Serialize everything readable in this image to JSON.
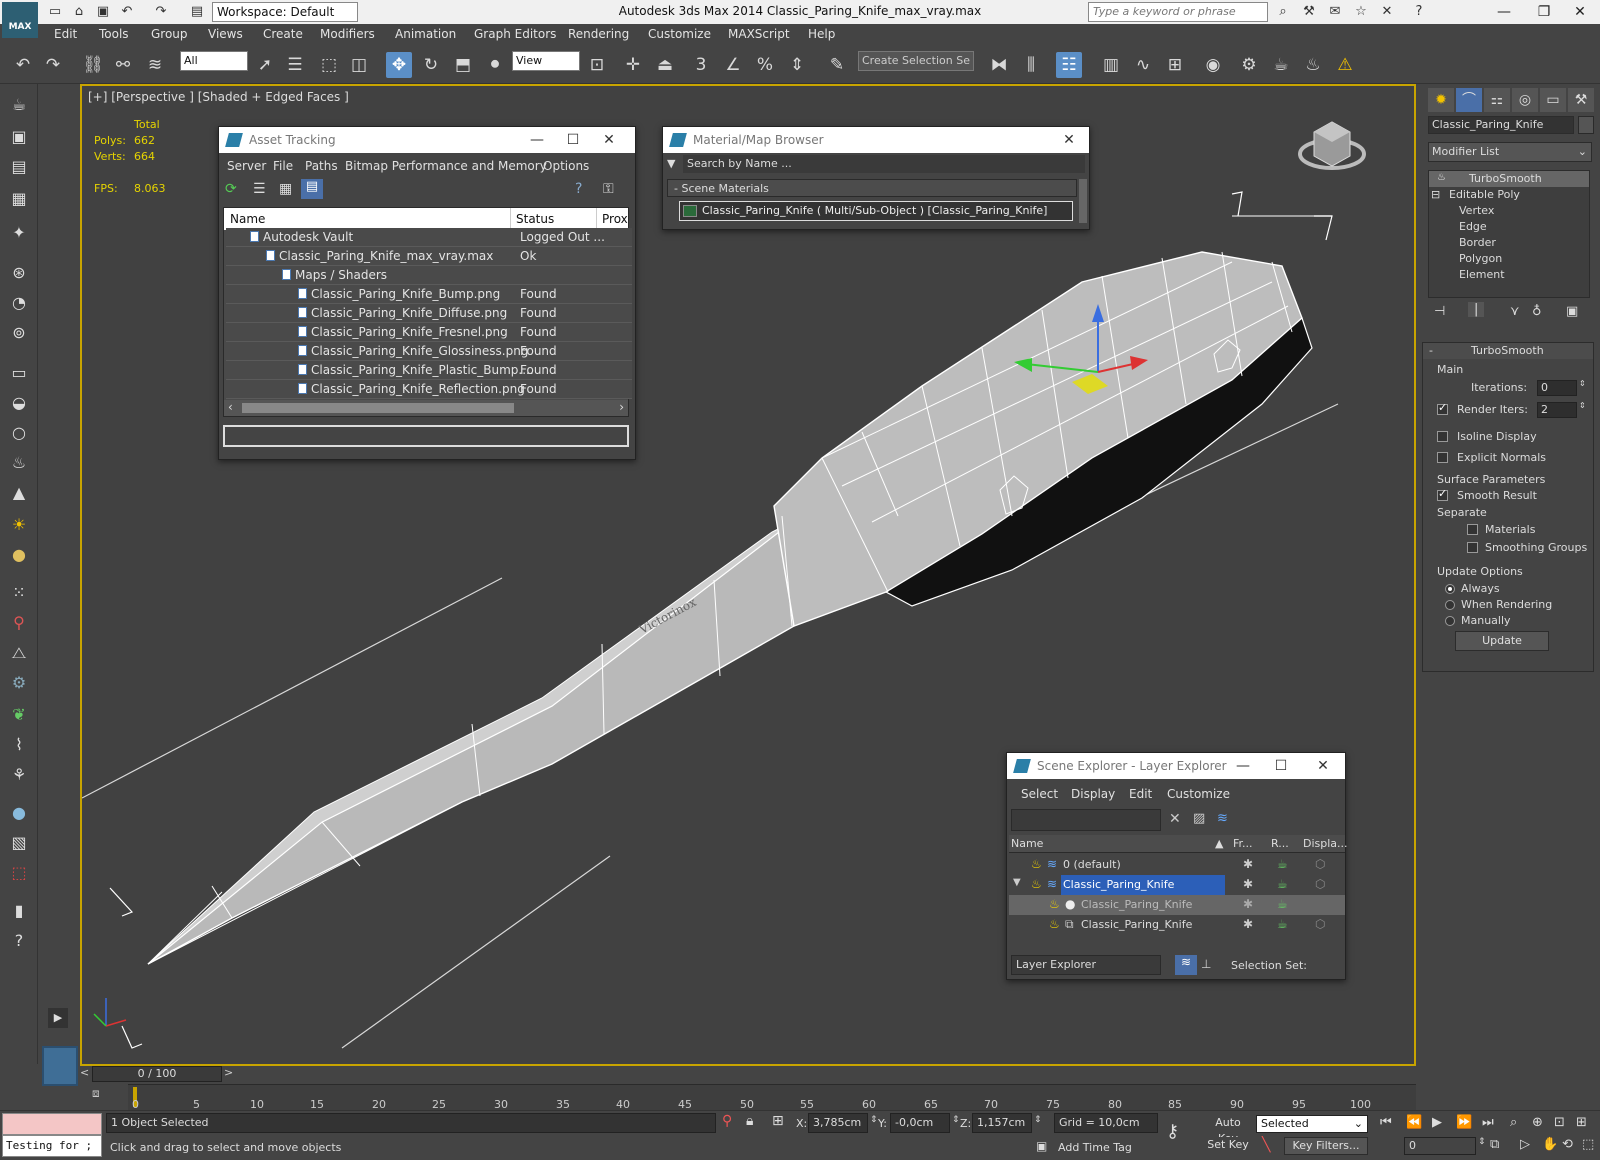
{
  "window": {
    "app_logo": "MAX",
    "workspace": "Workspace: Default",
    "title": "Autodesk 3ds Max  2014     Classic_Paring_Knife_max_vray.max",
    "search_placeholder": "Type a keyword or phrase"
  },
  "menu": [
    "Edit",
    "Tools",
    "Group",
    "Views",
    "Create",
    "Modifiers",
    "Animation",
    "Graph Editors",
    "Rendering",
    "Customize",
    "MAXScript",
    "Help"
  ],
  "toolbar": {
    "filter": "All",
    "ref_coord": "View",
    "selection_set_placeholder": "Create Selection Se",
    "snap_label": "3",
    "angle_label": "%"
  },
  "viewport": {
    "label": "[+] [Perspective ] [Shaded + Edged Faces ]",
    "stats": {
      "total_label": "Total",
      "polys_label": "Polys:",
      "polys": "662",
      "verts_label": "Verts:",
      "verts": "664",
      "fps_label": "FPS:",
      "fps": "8.063"
    }
  },
  "asset_tracking": {
    "title": "Asset Tracking",
    "menu": [
      "Server",
      "File",
      "Paths",
      "Bitmap Performance and Memory",
      "Options"
    ],
    "columns": [
      "Name",
      "Status",
      "Prox"
    ],
    "rows": [
      {
        "name": "Autodesk Vault",
        "status": "Logged Out ..."
      },
      {
        "name": "Classic_Paring_Knife_max_vray.max",
        "status": "Ok"
      },
      {
        "name": "Maps / Shaders",
        "status": ""
      },
      {
        "name": "Classic_Paring_Knife_Bump.png",
        "status": "Found"
      },
      {
        "name": "Classic_Paring_Knife_Diffuse.png",
        "status": "Found"
      },
      {
        "name": "Classic_Paring_Knife_Fresnel.png",
        "status": "Found"
      },
      {
        "name": "Classic_Paring_Knife_Glossiness.png",
        "status": "Found"
      },
      {
        "name": "Classic_Paring_Knife_Plastic_Bump....",
        "status": "Found"
      },
      {
        "name": "Classic_Paring_Knife_Reflection.png",
        "status": "Found"
      }
    ]
  },
  "material_browser": {
    "title": "Material/Map Browser",
    "search_placeholder": "Search by Name ...",
    "group": "- Scene Materials",
    "item": "Classic_Paring_Knife  ( Multi/Sub-Object ) [Classic_Paring_Knife]"
  },
  "scene_explorer": {
    "title": "Scene Explorer - Layer Explorer",
    "menu": [
      "Select",
      "Display",
      "Edit",
      "Customize"
    ],
    "columns": [
      "Name",
      "Fr...",
      "R...",
      "Displa..."
    ],
    "rows": [
      {
        "name": "0 (default)"
      },
      {
        "name": "Classic_Paring_Knife"
      },
      {
        "name": "Classic_Paring_Knife"
      },
      {
        "name": "Classic_Paring_Knife"
      }
    ],
    "footer_select": "Layer Explorer",
    "selection_set_label": "Selection Set:"
  },
  "command_panel": {
    "object_name": "Classic_Paring_Knife",
    "modifier_list": "Modifier List",
    "stack": [
      "TurboSmooth",
      "Editable Poly",
      "Vertex",
      "Edge",
      "Border",
      "Polygon",
      "Element"
    ],
    "rollout_title": "TurboSmooth",
    "main_label": "Main",
    "iterations_label": "Iterations:",
    "iterations": "0",
    "render_iters_label": "Render Iters:",
    "render_iters": "2",
    "isoline": "Isoline Display",
    "explicit_normals": "Explicit Normals",
    "surface_params": "Surface Parameters",
    "smooth_result": "Smooth Result",
    "separate": "Separate",
    "materials": "Materials",
    "smoothing_groups": "Smoothing Groups",
    "update_options": "Update Options",
    "always": "Always",
    "when_rendering": "When Rendering",
    "manually": "Manually",
    "update_button": "Update"
  },
  "timeline": {
    "slider": "0 / 100",
    "ticks": [
      "0",
      "5",
      "10",
      "15",
      "20",
      "25",
      "30",
      "35",
      "40",
      "45",
      "50",
      "55",
      "60",
      "65",
      "70",
      "75",
      "80",
      "85",
      "90",
      "95",
      "100"
    ]
  },
  "status": {
    "listener": "Testing for ;",
    "selected": "1 Object Selected",
    "prompt": "Click and drag to select and move objects",
    "x_label": "X:",
    "x": "3,785cm",
    "y_label": "Y:",
    "y": "-0,0cm",
    "z_label": "Z:",
    "z": "1,157cm",
    "grid": "Grid = 10,0cm",
    "add_time_tag": "Add Time Tag",
    "auto_key": "Auto Key",
    "set_key": "Set Key",
    "key_mode": "Selected",
    "key_filters": "Key Filters...",
    "frame": "0"
  }
}
